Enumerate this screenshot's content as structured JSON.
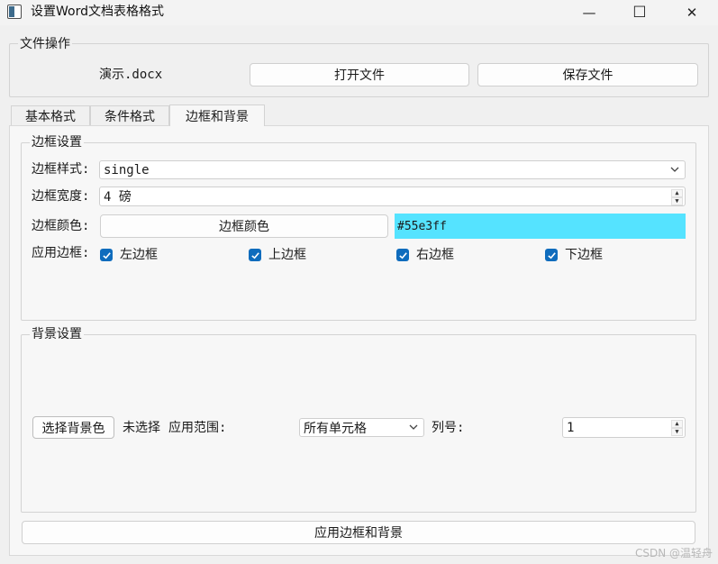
{
  "window": {
    "title": "设置Word文档表格格式",
    "minimize_glyph": "—",
    "maximize_glyph": "☐",
    "close_glyph": "✕"
  },
  "file_ops": {
    "legend": "文件操作",
    "file_name": "演示.docx",
    "open_label": "打开文件",
    "save_label": "保存文件"
  },
  "tabs": [
    {
      "label": "基本格式",
      "active": false
    },
    {
      "label": "条件格式",
      "active": false
    },
    {
      "label": "边框和背景",
      "active": true
    }
  ],
  "border_settings": {
    "legend": "边框设置",
    "style_label": "边框样式:",
    "style_value": "single",
    "width_label": "边框宽度:",
    "width_value": "4 磅",
    "color_label": "边框颜色:",
    "color_button": "边框颜色",
    "color_value": "#55e3ff",
    "apply_label": "应用边框:",
    "checkboxes": [
      {
        "label": "左边框",
        "checked": true
      },
      {
        "label": "上边框",
        "checked": true
      },
      {
        "label": "右边框",
        "checked": true
      },
      {
        "label": "下边框",
        "checked": true
      }
    ]
  },
  "background_settings": {
    "legend": "背景设置",
    "choose_button": "选择背景色",
    "status": "未选择",
    "scope_label": "应用范围:",
    "scope_value": "所有单元格",
    "column_label": "列号:",
    "column_value": "1"
  },
  "apply_button": "应用边框和背景",
  "watermark": "CSDN @温轻舟",
  "colors": {
    "accent": "#0f6cbd",
    "swatch": "#55e3ff"
  }
}
